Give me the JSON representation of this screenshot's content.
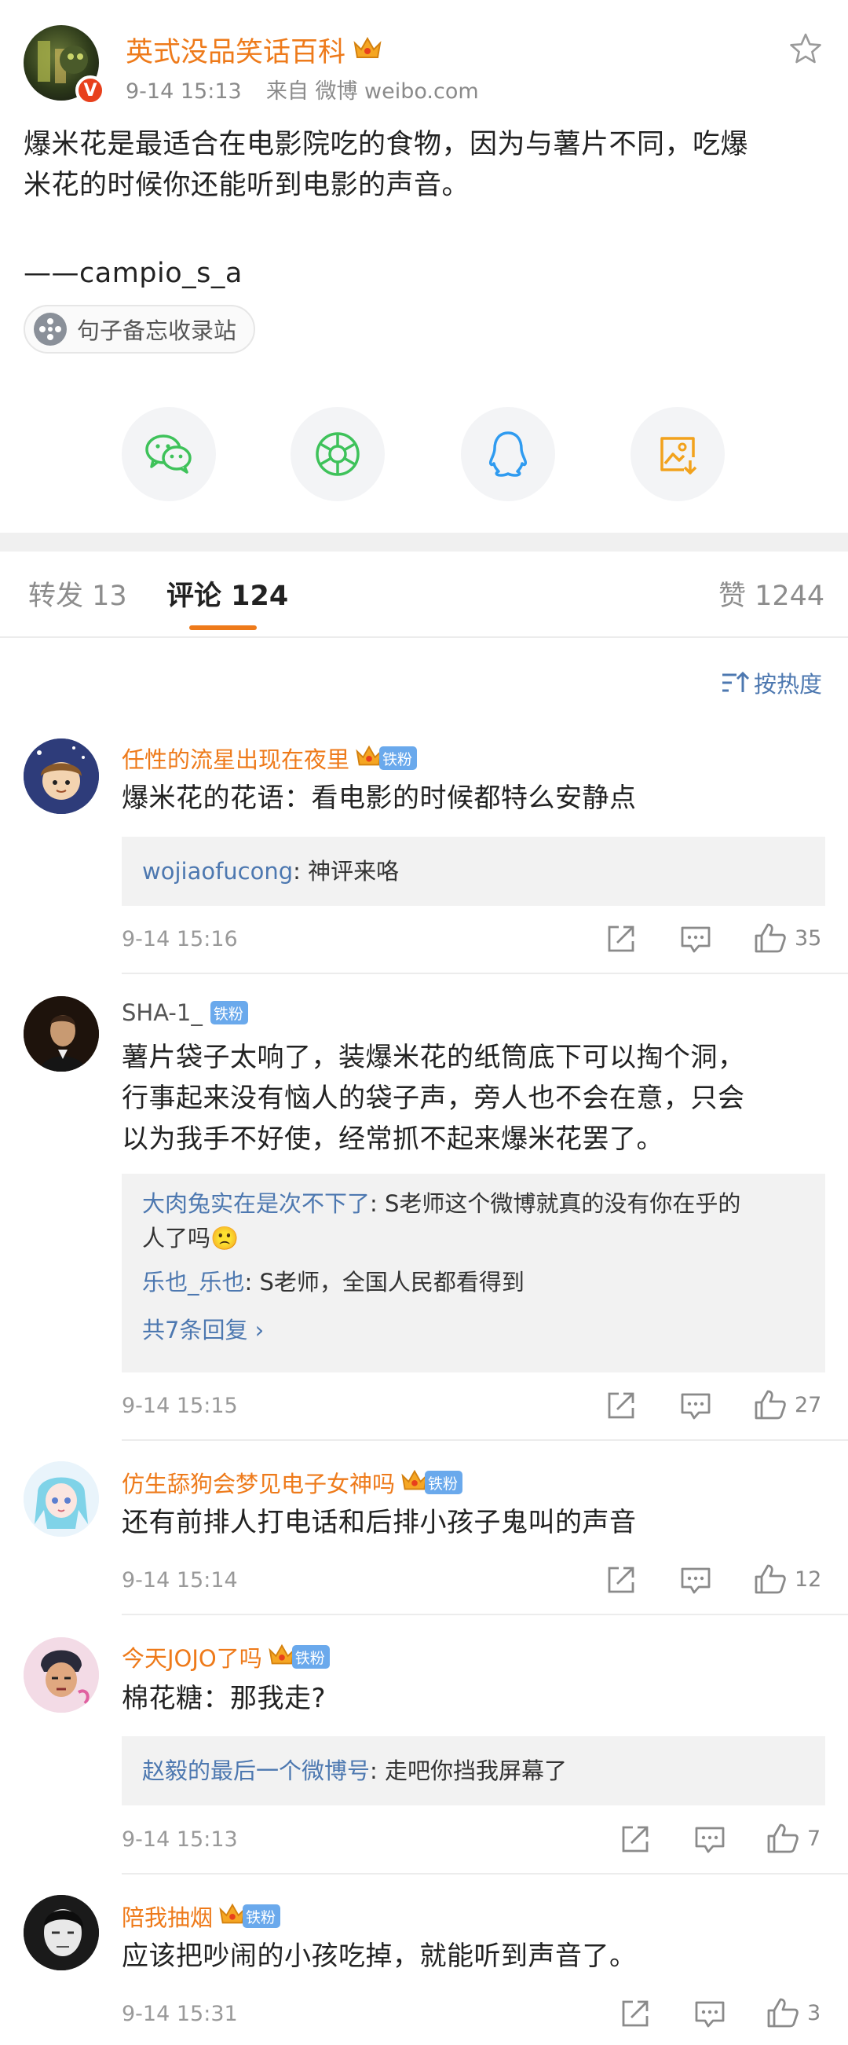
{
  "post": {
    "author": "英式没品笑话百科",
    "time": "9-14 15:13",
    "source": "来自 微博 weibo.com",
    "verified_mark": "V",
    "text_line1": "爆米花是最适合在电影院吃的食物，因为与薯片不同，吃爆",
    "text_line2": "米花的时候你还能听到电影的声音。",
    "credit": "——campio_s_a",
    "tag_chip": "句子备忘收录站"
  },
  "share": {
    "icons": [
      "wechat-icon",
      "moments-icon",
      "qq-icon",
      "save-image-icon"
    ],
    "colors": {
      "wechat": "#3ec25a",
      "moments": "#3ec25a",
      "qq": "#2f9bf0",
      "save": "#f2a21c"
    }
  },
  "tabs": {
    "repost": "转发 13",
    "comment": "评论 124",
    "like": "赞 1244",
    "sort": "按热度"
  },
  "badge_label": "铁粉",
  "comments": [
    {
      "name": "任性的流星出现在夜里",
      "text": "爆米花的花语：看电影的时候都特么安静点",
      "replies": [
        {
          "user": "wojiaofucong",
          "text": ": 神评来咯"
        }
      ],
      "time": "9-14 15:16",
      "likes": "35"
    },
    {
      "name": "SHA-1_",
      "text_lines": [
        "薯片袋子太响了，装爆米花的纸筒底下可以掏个洞，",
        "行事起来没有恼人的袋子声，旁人也不会在意，只会",
        "以为我手不好使，经常抓不起来爆米花罢了。"
      ],
      "replies": [
        {
          "user": "大肉兔实在是次不下了",
          "text": ": S老师这个微博就真的没有你在乎的",
          "text2": "人了吗🙁"
        },
        {
          "user": "乐也_乐也",
          "text": ": S老师，全国人民都看得到"
        }
      ],
      "more": "共7条回复 ›",
      "time": "9-14 15:15",
      "likes": "27"
    },
    {
      "name": "仿生舔狗会梦见电子女神吗",
      "text": "还有前排人打电话和后排小孩子鬼叫的声音",
      "time": "9-14 15:14",
      "likes": "12"
    },
    {
      "name": "今天JOJO了吗",
      "text": "棉花糖：那我走?",
      "replies": [
        {
          "user": "赵毅的最后一个微博号",
          "text": ": 走吧你挡我屏幕了"
        }
      ],
      "time": "9-14 15:13",
      "likes": "7"
    },
    {
      "name": "陪我抽烟",
      "text": "应该把吵闹的小孩吃掉，就能听到声音了。",
      "time": "9-14 15:31",
      "likes": "3"
    }
  ]
}
